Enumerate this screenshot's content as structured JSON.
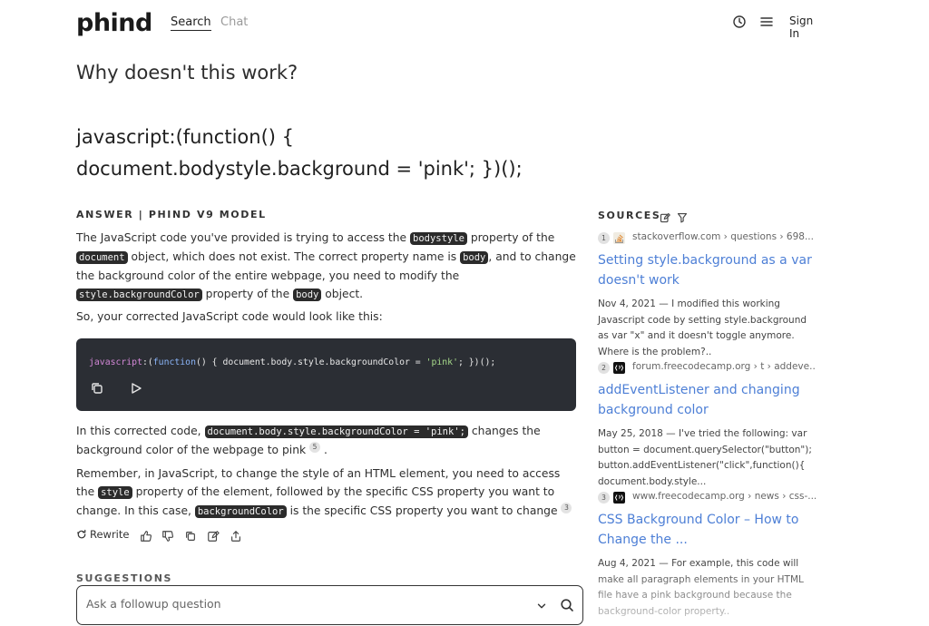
{
  "header": {
    "logo": "phind",
    "tabs": [
      {
        "label": "Search",
        "active": true
      },
      {
        "label": "Chat",
        "active": false
      }
    ],
    "history_icon": "clock-icon",
    "menu_icon": "hamburger-icon",
    "signin_label": "Sign In"
  },
  "question": {
    "title": "Why doesn't this work?",
    "code_line1": "javascript:(function() {",
    "code_line2": "document.bodystyle.background = 'pink'; })();"
  },
  "answer": {
    "heading": "ANSWER | PHIND V9 MODEL",
    "p1": {
      "t1": "The JavaScript code you've provided is trying to access the ",
      "c1": "bodystyle",
      "t2": " property of the ",
      "c2": "document",
      "t3": " object, which does not exist. The correct property name is ",
      "c3": "body",
      "t4": ", and to change the background color of the entire webpage, you need to modify the ",
      "c4": "style.backgroundColor",
      "t5": " property of the ",
      "c5": "body",
      "t6": " object."
    },
    "p2": "So, your corrected JavaScript code would look like this:",
    "code": {
      "keyword": "javascript",
      "rest1": ":(",
      "fn": "function",
      "rest2": "() { document.body.style.backgroundColor = ",
      "string": "'pink'",
      "rest3": "; })();"
    },
    "p3": {
      "t1": "In this corrected code, ",
      "c1": "document.body.style.backgroundColor = 'pink';",
      "t2": " changes the background color of the webpage to pink",
      "cite": "5",
      "t3": " ."
    },
    "p4": {
      "t1": "Remember, in JavaScript, to change the style of an HTML element, you need to access the ",
      "c1": "style",
      "t2": " property of the element, followed by the specific CSS property you want to change. In this case, ",
      "c2": "backgroundColor",
      "t3": " is the specific CSS property you want to change",
      "cite": "3",
      "t4": " ."
    },
    "actions": {
      "rewrite_label": "Rewrite",
      "icons": [
        "thumbs-up-icon",
        "thumbs-down-icon",
        "copy-icon",
        "edit-icon",
        "share-icon"
      ]
    }
  },
  "suggestions": {
    "heading": "SUGGESTIONS",
    "placeholder": "Ask a followup question"
  },
  "sources": {
    "heading": "SOURCES",
    "items": [
      {
        "num": "1",
        "domain": "stackoverflow.com › questions › 698...",
        "title": "Setting style.background as a var doesn't work",
        "snippet": "Nov 4, 2021 — I modified this working Javascript code by setting style.background as var \"x\" and it doesn't toggle anymore. Where is the problem?.."
      },
      {
        "num": "2",
        "domain": "forum.freecodecamp.org › t › addeve...",
        "title": "addEventListener and changing background color",
        "snippet": "May 25, 2018 — I've tried the following: var button = document.querySelector(\"button\"); button.addEventListener(\"click\",function(){ document.body.style..."
      },
      {
        "num": "3",
        "domain": "www.freecodecamp.org › news › css-...",
        "title": "CSS Background Color – How to Change the ...",
        "snippet": "Aug 4, 2021 — For example, this code will make all paragraph elements in your HTML file have a pink background because the background-color property.."
      }
    ]
  },
  "colors": {
    "link": "#4d7fd6",
    "code_bg": "#2b2e34",
    "chip_bg": "#2b2b2b"
  }
}
